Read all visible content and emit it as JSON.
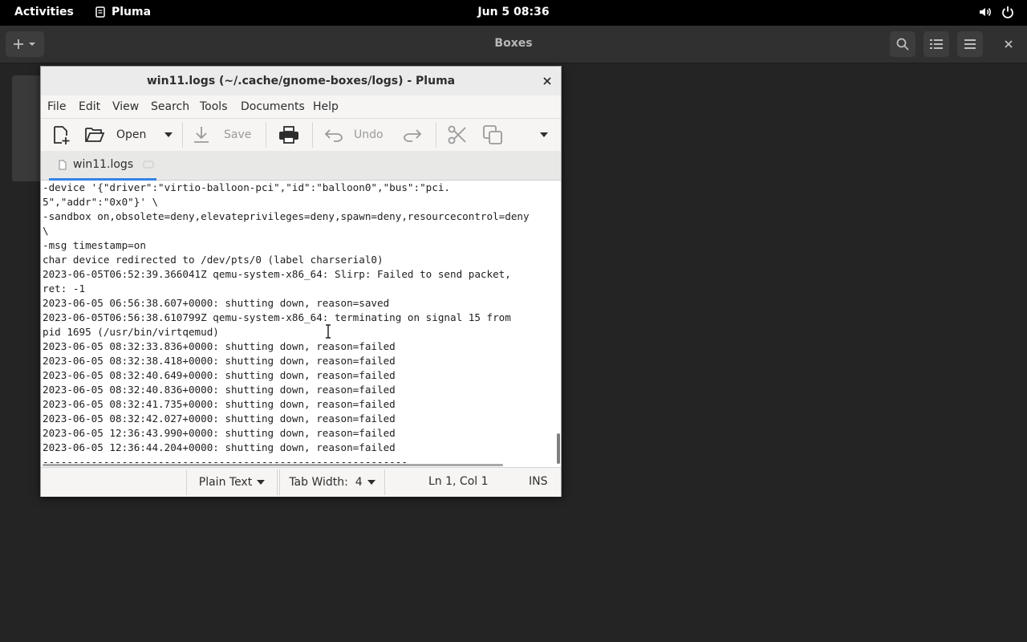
{
  "topbar": {
    "activities": "Activities",
    "app_name": "Pluma",
    "clock": "Jun 5  08:36",
    "tray_icons": [
      "volume-icon",
      "power-icon"
    ]
  },
  "boxes": {
    "title": "Boxes",
    "buttons": [
      "add-icon",
      "search-icon",
      "list-view-icon",
      "menu-icon",
      "close-icon"
    ]
  },
  "pluma": {
    "title": "win11.logs (~/.cache/gnome-boxes/logs) - Pluma",
    "menu": [
      "File",
      "Edit",
      "View",
      "Search",
      "Tools",
      "Documents",
      "Help"
    ],
    "toolbar": {
      "open_label": "Open",
      "save_label": "Save",
      "undo_label": "Undo"
    },
    "tab_label": "win11.logs",
    "lines": [
      "-device '{\"driver\":\"virtio-balloon-pci\",\"id\":\"balloon0\",\"bus\":\"pci.",
      "5\",\"addr\":\"0x0\"}' \\",
      "-sandbox on,obsolete=deny,elevateprivileges=deny,spawn=deny,resourcecontrol=deny",
      "\\",
      "-msg timestamp=on",
      "char device redirected to /dev/pts/0 (label charserial0)",
      "2023-06-05T06:52:39.366041Z qemu-system-x86_64: Slirp: Failed to send packet,",
      "ret: -1",
      "2023-06-05 06:56:38.607+0000: shutting down, reason=saved",
      "2023-06-05T06:56:38.610799Z qemu-system-x86_64: terminating on signal 15 from",
      "pid 1695 (/usr/bin/virtqemud)",
      "2023-06-05 08:32:33.836+0000: shutting down, reason=failed",
      "2023-06-05 08:32:38.418+0000: shutting down, reason=failed",
      "2023-06-05 08:32:40.649+0000: shutting down, reason=failed",
      "2023-06-05 08:32:40.836+0000: shutting down, reason=failed",
      "2023-06-05 08:32:41.735+0000: shutting down, reason=failed",
      "2023-06-05 08:32:42.027+0000: shutting down, reason=failed",
      "2023-06-05 12:36:43.990+0000: shutting down, reason=failed",
      "2023-06-05 12:36:44.204+0000: shutting down, reason=failed",
      "------------------------------------------------------------"
    ],
    "status": {
      "language": "Plain Text",
      "tab_width": "Tab Width:  4",
      "position": "Ln 1, Col 1",
      "mode": "INS"
    }
  },
  "colors": {
    "accent": "#3584e4",
    "topbar": "#000000",
    "desktop": "#242424"
  }
}
